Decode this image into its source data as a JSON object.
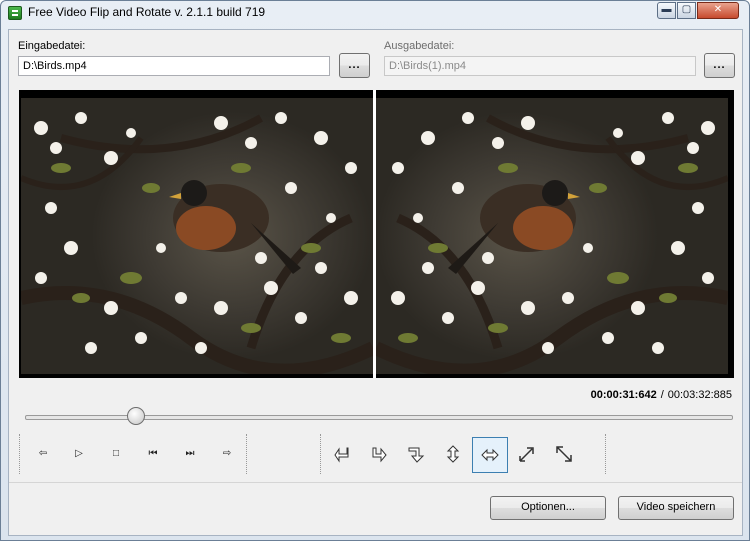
{
  "window": {
    "title": "Free Video Flip and Rotate  v. 2.1.1 build 719",
    "min_glyph": "▬",
    "max_glyph": "▢",
    "close_glyph": "✕"
  },
  "input": {
    "label": "Eingabedatei:",
    "value": "D:\\Birds.mp4",
    "browse_label": "..."
  },
  "output": {
    "label": "Ausgabedatei:",
    "value": "D:\\Birds(1).mp4",
    "browse_label": "..."
  },
  "playback": {
    "current_time": "00:00:31:642",
    "separator": "/",
    "total_time": "00:03:32:885",
    "progress_fraction": 0.148
  },
  "controls": [
    {
      "name": "prev-frame-icon",
      "glyph": "⇦"
    },
    {
      "name": "play-icon",
      "glyph": "▷"
    },
    {
      "name": "stop-icon",
      "glyph": "□"
    },
    {
      "name": "skip-start-icon",
      "glyph": "⏮"
    },
    {
      "name": "skip-end-icon",
      "glyph": "⏭"
    },
    {
      "name": "next-frame-icon",
      "glyph": "⇨"
    }
  ],
  "transforms": [
    {
      "name": "rotate-left-icon"
    },
    {
      "name": "rotate-right-icon"
    },
    {
      "name": "rotate-down-icon"
    },
    {
      "name": "flip-vertical-icon"
    },
    {
      "name": "flip-horizontal-icon",
      "active": true
    },
    {
      "name": "diagonal-up-icon"
    },
    {
      "name": "diagonal-down-icon"
    }
  ],
  "buttons": {
    "options": "Optionen...",
    "save": "Video speichern"
  },
  "colors": {
    "accent": "#3c7fb1",
    "preview_bg": "#000000"
  }
}
